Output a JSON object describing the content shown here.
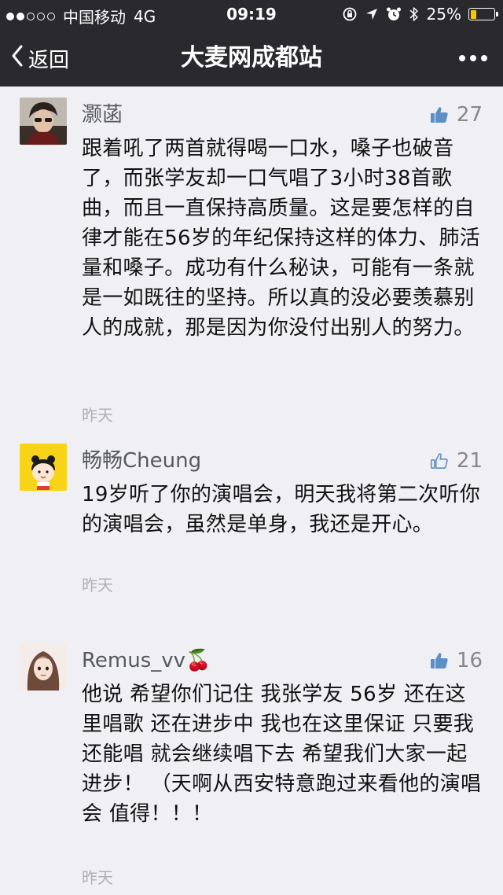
{
  "status_bar": {
    "carrier": "中国移动",
    "network": "4G",
    "time": "09:19",
    "battery_text": "25%",
    "battery_level": 0.25,
    "battery_color": "#f7c600"
  },
  "nav": {
    "back_label": "返回",
    "title": "大麦网成都站",
    "more_icon": "more-horizontal-icon"
  },
  "comments": [
    {
      "username": "灏菡",
      "likes": "27",
      "liked": true,
      "text": "跟着吼了两首就得喝一口水，嗓子也破音了，而张学友却一口气唱了3小时38首歌曲，而且一直保持高质量。这是要怎样的自律才能在56岁的年纪保持这样的体力、肺活量和嗓子。成功有什么秘诀，可能有一条就是一如既往的坚持。所以真的没必要羡慕别人的成就，那是因为你没付出别人的努力。",
      "time": "昨天"
    },
    {
      "username": "畅畅Cheung",
      "likes": "21",
      "liked": false,
      "text": "19岁听了你的演唱会，明天我将第二次听你的演唱会，虽然是单身，我还是开心。",
      "time": "昨天"
    },
    {
      "username": "Remus_vv🍒",
      "likes": "16",
      "liked": true,
      "text": "他说 希望你们记住 我张学友 56岁 还在这里唱歌 还在进步中 我也在这里保证 只要我还能唱 就会继续唱下去 希望我们大家一起进步！ （天啊从西安特意跑过来看他的演唱会 值得！！！",
      "time": "昨天"
    }
  ]
}
